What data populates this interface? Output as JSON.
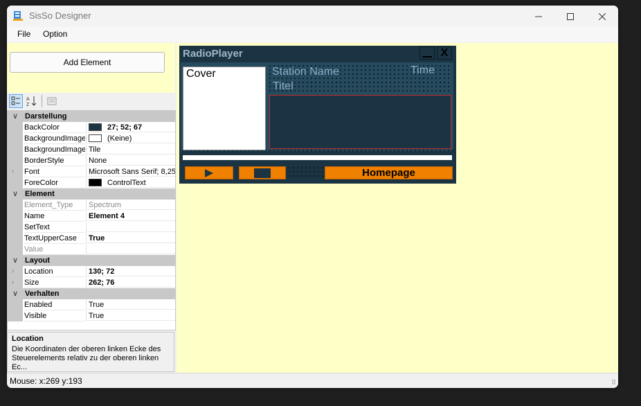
{
  "window": {
    "title": "SisSo Designer"
  },
  "menu": {
    "items": [
      "File",
      "Option"
    ]
  },
  "left": {
    "add_button_label": "Add Element"
  },
  "properties": {
    "categories": [
      {
        "name": "Darstellung",
        "props": [
          {
            "name": "BackColor",
            "value": "27; 52; 67",
            "swatch": "#1b3443",
            "bold": true
          },
          {
            "name": "BackgroundImage",
            "value": "(Keine)",
            "swatch": "#ffffff"
          },
          {
            "name": "BackgroundImageLayout",
            "value": "Tile"
          },
          {
            "name": "BorderStyle",
            "value": "None"
          },
          {
            "name": "Font",
            "value": "Microsoft Sans Serif; 8,25pt",
            "expandable": true
          },
          {
            "name": "ForeColor",
            "value": "ControlText",
            "swatch": "#000000"
          }
        ]
      },
      {
        "name": "Element",
        "props": [
          {
            "name": "Element_Type",
            "value": "Spectrum",
            "readonly": true
          },
          {
            "name": "Name",
            "value": "Element 4",
            "bold": true
          },
          {
            "name": "SetText",
            "value": ""
          },
          {
            "name": "TextUpperCase",
            "value": "True",
            "bold": true
          },
          {
            "name": "Value",
            "value": "",
            "readonly": true
          }
        ]
      },
      {
        "name": "Layout",
        "props": [
          {
            "name": "Location",
            "value": "130; 72",
            "bold": true,
            "expandable": true
          },
          {
            "name": "Size",
            "value": "262; 76",
            "bold": true,
            "expandable": true
          }
        ]
      },
      {
        "name": "Verhalten",
        "props": [
          {
            "name": "Enabled",
            "value": "True"
          },
          {
            "name": "Visible",
            "value": "True"
          }
        ]
      }
    ]
  },
  "description": {
    "title": "Location",
    "text": "Die Koordinaten der oberen linken Ecke des Steuerelements relativ zu der oberen linken Ec..."
  },
  "status": {
    "text": "Mouse: x:269 y:193"
  },
  "designer": {
    "title": "RadioPlayer",
    "close_label": "X",
    "cover_label": "Cover",
    "station_label": "Station Name",
    "time_label": "Time",
    "titel_label": "Titel",
    "homepage_label": "Homepage"
  },
  "colors": {
    "canvas_bg": "#ffffc8",
    "player_bg": "#1b3443",
    "button_orange": "#f08000",
    "selection_border": "#c62828"
  }
}
